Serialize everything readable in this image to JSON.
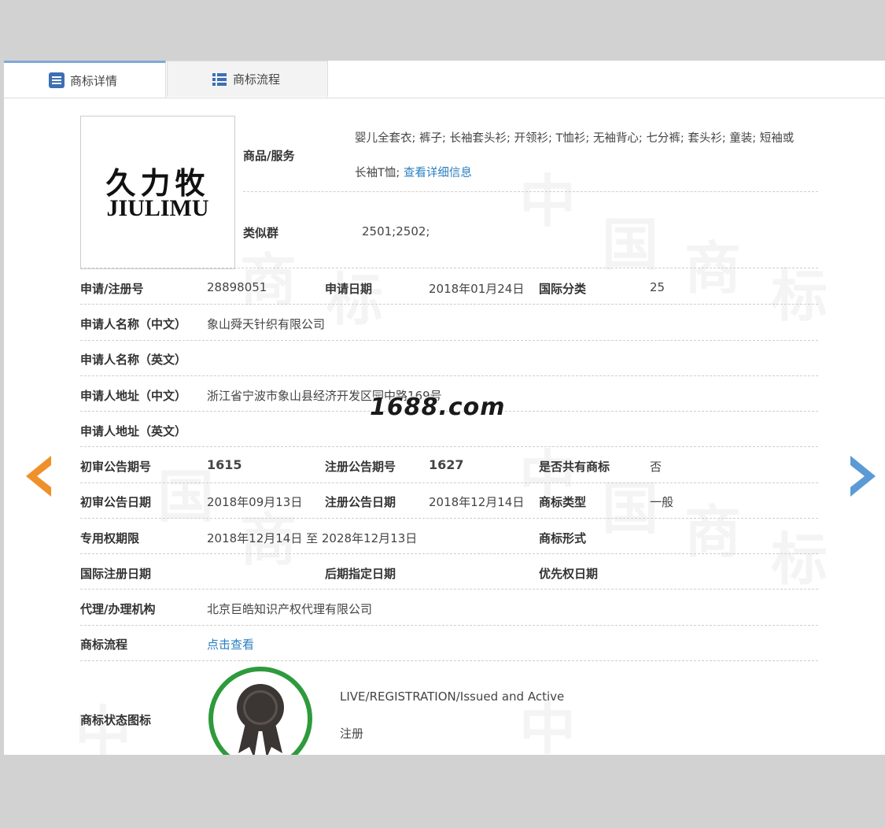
{
  "tabs": {
    "detail": "商标详情",
    "process": "商标流程"
  },
  "logo": {
    "cn": "久力牧",
    "en": "JIULIMU"
  },
  "goods": {
    "label": "商品/服务",
    "line1": "婴儿全套衣; 裤子; 长袖套头衫; 开领衫; T恤衫; 无袖背心; 七分裤; 套头衫; 童装; 短袖或",
    "line2": "长袖T恤;",
    "link": "查看详细信息"
  },
  "similar_group": {
    "label": "类似群",
    "value": "2501;2502;"
  },
  "rows": {
    "reg_no": {
      "label": "申请/注册号",
      "value": "28898051"
    },
    "apply_date": {
      "label": "申请日期",
      "value": "2018年01月24日"
    },
    "intl_class": {
      "label": "国际分类",
      "value": "25"
    },
    "applicant_cn": {
      "label": "申请人名称（中文）",
      "value": "象山舜天针织有限公司"
    },
    "applicant_en": {
      "label": "申请人名称（英文）",
      "value": ""
    },
    "address_cn": {
      "label": "申请人地址（中文）",
      "value": "浙江省宁波市象山县经济开发区园中路169号"
    },
    "address_en": {
      "label": "申请人地址（英文）",
      "value": ""
    },
    "prelim_issue": {
      "label": "初审公告期号",
      "value": "1615"
    },
    "reg_issue": {
      "label": "注册公告期号",
      "value": "1627"
    },
    "shared": {
      "label": "是否共有商标",
      "value": "否"
    },
    "prelim_date": {
      "label": "初审公告日期",
      "value": "2018年09月13日"
    },
    "reg_date": {
      "label": "注册公告日期",
      "value": "2018年12月14日"
    },
    "tm_type": {
      "label": "商标类型",
      "value": "一般"
    },
    "exclusive_period": {
      "label": "专用权期限",
      "value": "2018年12月14日 至 2028年12月13日"
    },
    "tm_form": {
      "label": "商标形式",
      "value": ""
    },
    "intl_reg_date": {
      "label": "国际注册日期",
      "value": ""
    },
    "later_date": {
      "label": "后期指定日期",
      "value": ""
    },
    "priority_date": {
      "label": "优先权日期",
      "value": ""
    },
    "agency": {
      "label": "代理/办理机构",
      "value": "北京巨皓知识产权代理有限公司"
    },
    "process": {
      "label": "商标流程",
      "link": "点击查看"
    }
  },
  "status": {
    "label": "商标状态图标",
    "line1": "LIVE/REGISTRATION/Issued and Active",
    "line2": "注册"
  },
  "watermark": "1688.com",
  "colors": {
    "link": "#2a7fc1",
    "arrow_left": "#f0902a",
    "arrow_right": "#5b9bd5",
    "badge_ring": "#2e9a3c"
  },
  "icons": {
    "tab_detail": "list-doc-icon",
    "tab_process": "list-grid-icon",
    "prev": "arrow-left-icon",
    "next": "arrow-right-icon",
    "badge": "award-ribbon-icon"
  }
}
